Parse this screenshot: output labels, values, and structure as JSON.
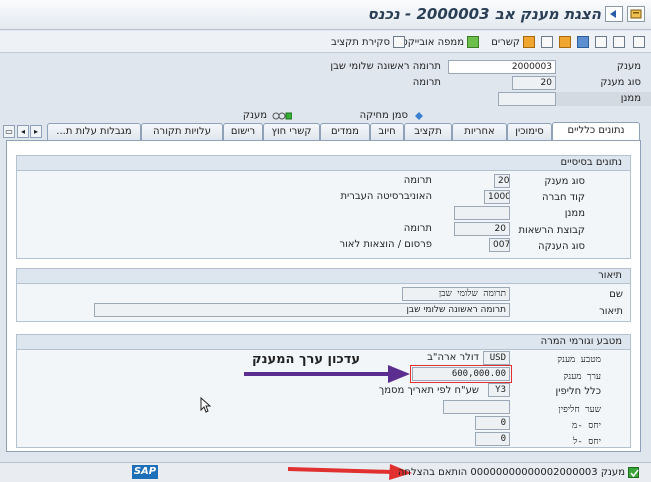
{
  "window": {
    "title": "הצגת מענק אב 2000003 - נכנס"
  },
  "toolbar": {
    "items": [
      {
        "label": "קשרים",
        "icon": "relations-icon"
      },
      {
        "label": "ממפה אובייקט",
        "icon": "object-mapper-icon"
      },
      {
        "label": "סקירת תקציב",
        "icon": "budget-overview-icon"
      }
    ]
  },
  "header": {
    "grant_label": "מענק",
    "grant_value": "2000003",
    "grant_desc": "תרומה ראשונה שלומי שבן",
    "grant_type_label": "סוג מענק",
    "grant_type_value": "20",
    "grant_type_desc": "תרומה",
    "sponsor_label": "ממנן",
    "sponsor_value": "",
    "legend_delete_flag": "סמן מחיקה",
    "legend_grant": "מענק"
  },
  "tabs": [
    {
      "label": "נתונים כלליים",
      "active": true
    },
    {
      "label": "סימוכין"
    },
    {
      "label": "אחריות"
    },
    {
      "label": "תקציב"
    },
    {
      "label": "חיוב"
    },
    {
      "label": "ממדים"
    },
    {
      "label": "קשרי חוץ"
    },
    {
      "label": "רישום"
    },
    {
      "label": "עלויות תקורה"
    },
    {
      "label": "מגבלות עלות ת..."
    }
  ],
  "basic_data": {
    "title": "נתונים בסיסיים",
    "grant_type_label": "סוג מענק",
    "grant_type_value": "20",
    "grant_type_desc": "תרומה",
    "company_code_label": "קוד חברה",
    "company_code_value": "1000",
    "company_code_desc": "האוניברסיטה העברית",
    "sponsor_label": "ממנן",
    "sponsor_value": "",
    "auth_group_label": "קבוצת הרשאות",
    "auth_group_value": "20",
    "auth_group_desc": "תרומה",
    "award_type_label": "סוג הענקה",
    "award_type_value": "007",
    "award_type_desc": "פרסום / הוצאות לאור"
  },
  "description": {
    "title": "תיאור",
    "name_label": "שם",
    "name_value": "תרומה שלומי שבן",
    "desc_label": "תיאור",
    "desc_value": "תרומה ראשונה שלומי שבן"
  },
  "currency": {
    "title": "מטבע וגורמי המרה",
    "grant_currency_label": "מטבע מענק",
    "grant_currency_value": "USD",
    "grant_currency_desc": "דולר ארה\"ב",
    "grant_value_label": "ערך מענק",
    "grant_value_value": "600,000.00",
    "exchange_rule_label": "כלל חליפין",
    "exchange_rule_value": "Y3",
    "exchange_rule_desc": "שע\"ח לפי תאריך מסמך",
    "exchange_rate_label": "שער חליפין",
    "exchange_rate_value": "",
    "ratio_from_label": "יחס -מ",
    "ratio_from_value": "0",
    "ratio_to_label": "יחס -ל",
    "ratio_to_value": "0"
  },
  "annotation": {
    "text": "עדכון ערך המענק",
    "arrow_color": "#5b2d8f",
    "status_arrow_color": "#e03030"
  },
  "status": {
    "message": "מענק 00000000000002000003 הותאם בהצלחה",
    "logo": "SAP"
  },
  "colors": {
    "sap_blue": "#1d6fb8",
    "highlight_red": "#e03030"
  }
}
